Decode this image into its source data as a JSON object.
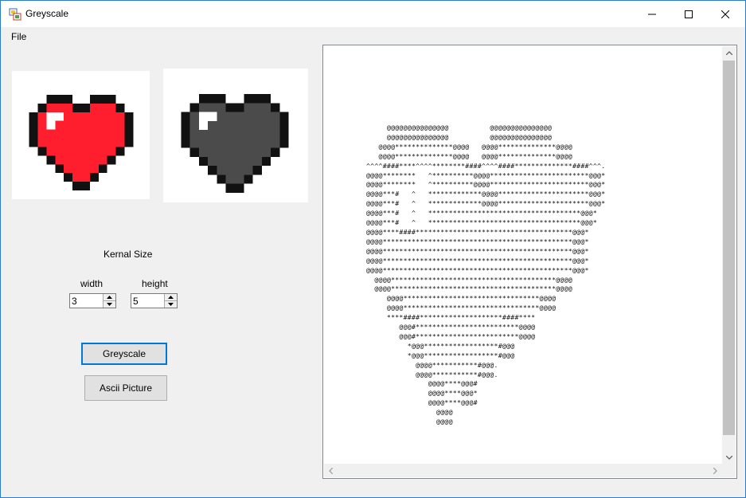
{
  "window": {
    "title": "Greyscale",
    "icon": "app-icon"
  },
  "controls": {
    "minimize": "minimize-icon",
    "maximize": "maximize-icon",
    "close": "close-icon"
  },
  "menu": {
    "items": [
      "File"
    ]
  },
  "images": {
    "original": {
      "name": "red-pixel-heart",
      "fill": "#ff1e2d"
    },
    "greyscale": {
      "name": "grey-pixel-heart",
      "fill": "#4b4b4b"
    }
  },
  "kernel": {
    "label": "Kernal Size",
    "width_label": "width",
    "height_label": "height",
    "width_value": "3",
    "height_value": "5"
  },
  "buttons": {
    "greyscale": "Greyscale",
    "ascii": "Ascii Picture"
  },
  "ascii": {
    "text": "     @@@@@@@@@@@@@@@          @@@@@@@@@@@@@@@\n     @@@@@@@@@@@@@@@          @@@@@@@@@@@@@@@\n   @@@@**************@@@@   @@@@**************@@@@\n   @@@@**************@@@@   @@@@**************@@@@\n^^^^####****^^^^********####^^^^####**************####^^^.\n@@@@********   ^**********@@@@************************@@@*\n@@@@********   ^**********@@@@************************@@@*\n@@@@***#   ^   *************@@@@**********************@@@*\n@@@@***#   ^   *************@@@@**********************@@@*\n@@@@***#   ^   *************************************@@@*\n@@@@***#   ^   *************************************@@@*\n@@@@****####**************************************@@@*\n@@@@**********************************************@@@*\n@@@@**********************************************@@@*\n@@@@**********************************************@@@*\n@@@@**********************************************@@@*\n  @@@@****************************************@@@@\n  @@@@****************************************@@@@\n     @@@@*********************************@@@@\n     @@@@*********************************@@@@\n     ****####********************####****\n        @@@#*************************@@@@\n        @@@#*************************@@@@\n          *@@@******************#@@@\n          *@@@******************#@@@\n            @@@@***********#@@@.\n            @@@@***********#@@@.\n               @@@@****@@@#\n               @@@@****@@@*\n               @@@@****@@@#\n                 @@@@\n                 @@@@"
  },
  "colors": {
    "accent": "#0078d7",
    "window_border": "#2b7bd1",
    "form_bg": "#f0f0f0"
  }
}
